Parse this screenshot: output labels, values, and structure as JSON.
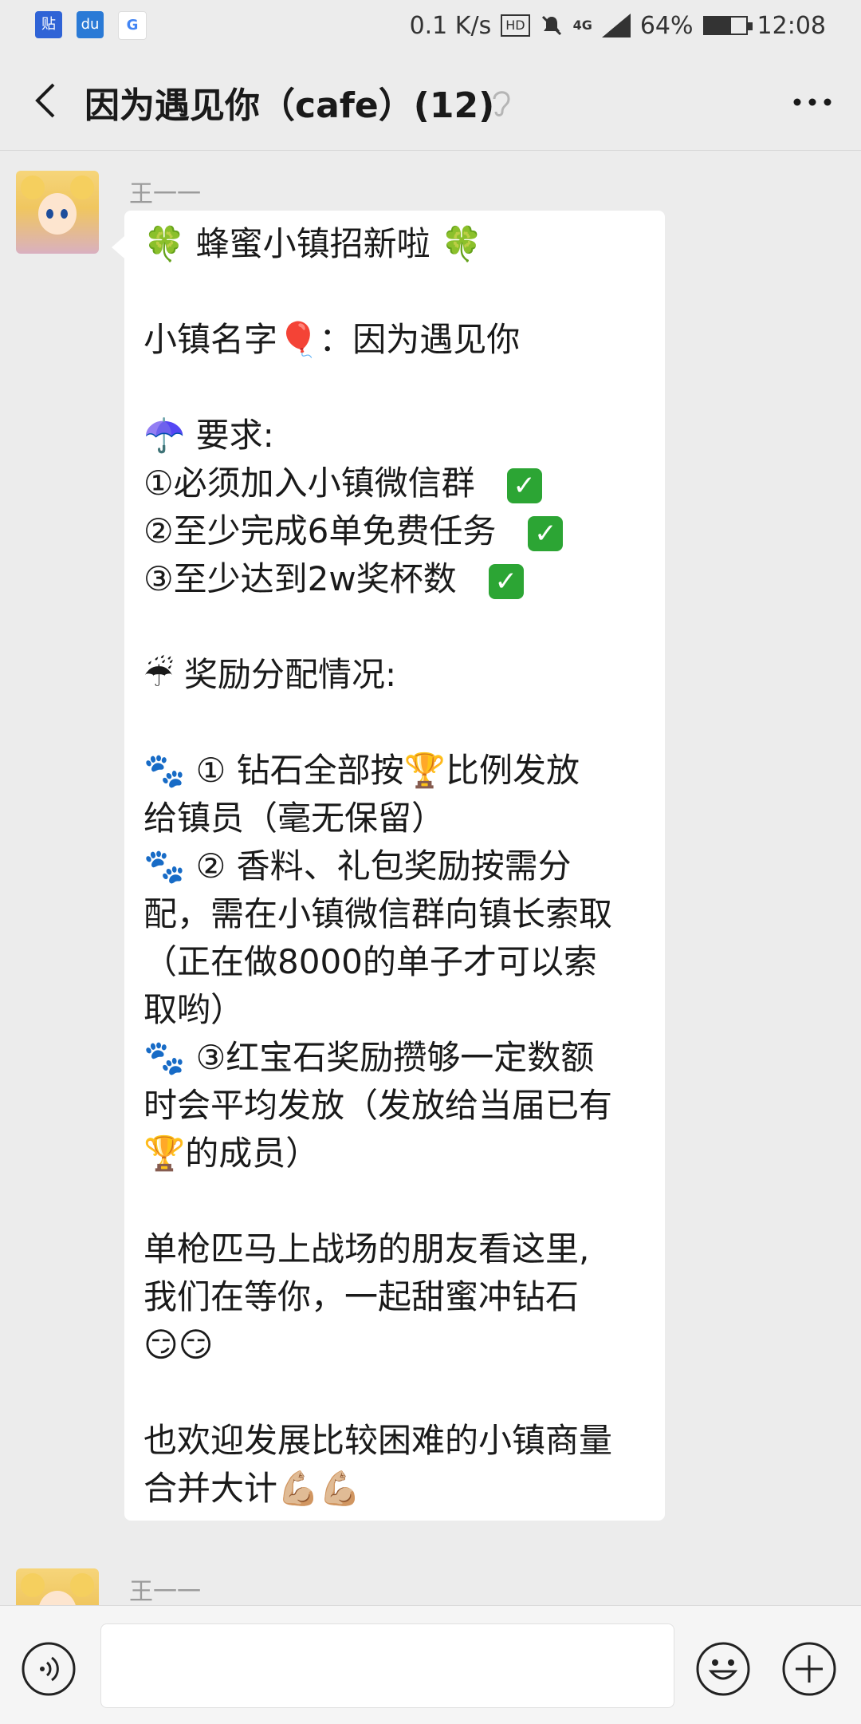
{
  "status_bar": {
    "net_speed": "0.1 K/s",
    "hd_label": "HD",
    "network": "4G",
    "battery_percent": "64%",
    "battery_level": 0.64,
    "time": "12:08"
  },
  "header": {
    "title": "因为遇见你（cafe）(12)"
  },
  "messages": [
    {
      "sender": "王一一",
      "lines": [
        "🍀 蜂蜜小镇招新啦 🍀",
        "",
        "小镇名字🎈：因为遇见你",
        "",
        "☂️ 要求:",
        "①必须加入小镇微信群",
        "②至少完成6单免费任务",
        "③至少达到2w奖杯数",
        "",
        "☔ 奖励分配情况:",
        "",
        "🐾 ① 钻石全部按🏆比例发放",
        "给镇员（毫无保留）",
        "🐾 ② 香料、礼包奖励按需分",
        "配，需在小镇微信群向镇长索取",
        "（正在做8000的单子才可以索",
        "取哟）",
        "🐾 ③红宝石奖励攒够一定数额",
        "时会平均发放（发放给当届已有",
        "🏆的成员）",
        "",
        "单枪匹马上战场的朋友看这里,",
        "我们在等你，一起甜蜜冲钻石",
        "😏😏",
        "",
        "也欢迎发展比较困难的小镇商量",
        "合并大计💪🏼💪🏼"
      ]
    },
    {
      "sender": "王一一"
    }
  ],
  "check_mark": "✓",
  "colors": {
    "background": "#ececec",
    "bubble": "#ffffff",
    "check_green": "#2ca534"
  },
  "icons": [
    "back-arrow-icon",
    "ear-icon",
    "more-icon",
    "voice-icon",
    "emoji-icon",
    "plus-icon"
  ]
}
